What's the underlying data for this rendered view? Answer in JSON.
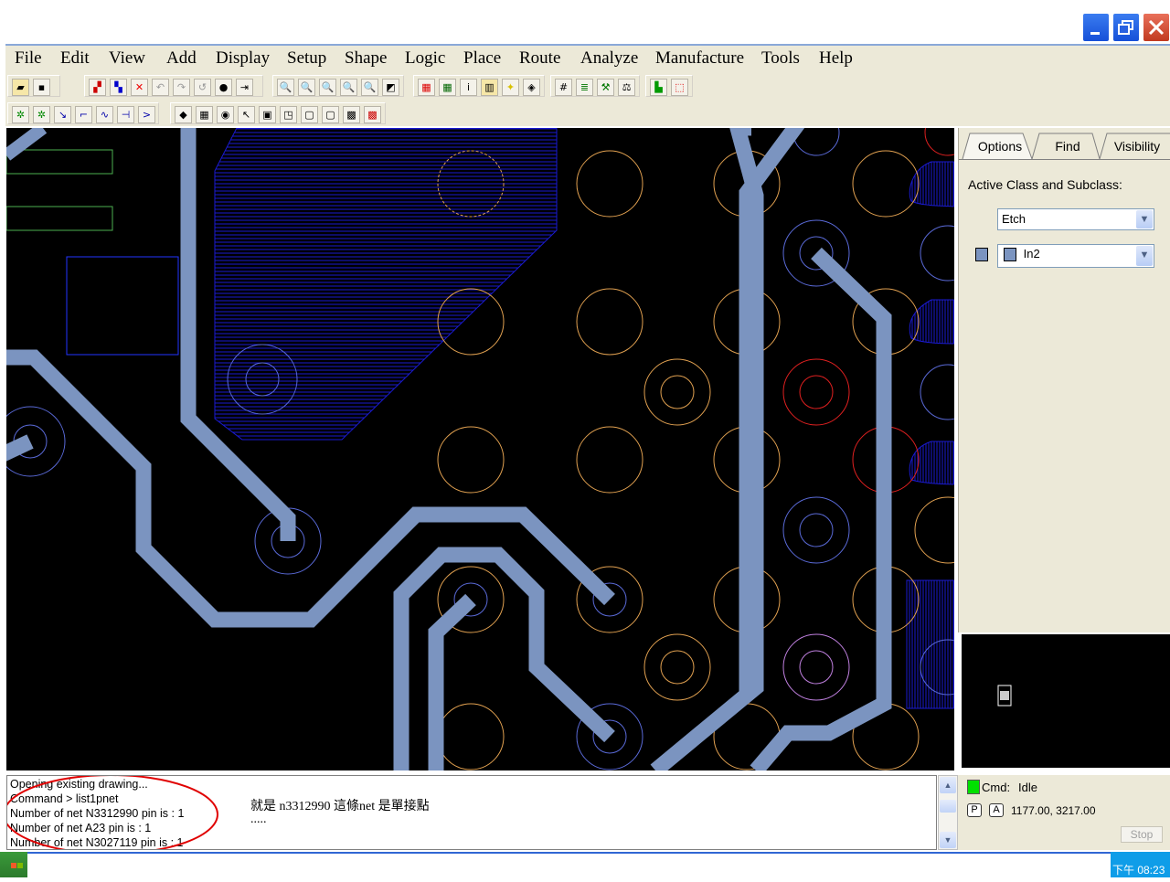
{
  "menu": [
    "File",
    "Edit",
    "View",
    "Add",
    "Display",
    "Setup",
    "Shape",
    "Logic",
    "Place",
    "Route",
    "Analyze",
    "Manufacture",
    "Tools",
    "Help"
  ],
  "panel": {
    "tabs": [
      "Options",
      "Find",
      "Visibility"
    ],
    "active_class_label": "Active Class and Subclass:",
    "class_value": "Etch",
    "subclass_value": "In2",
    "subclass_color": "#7b94c0"
  },
  "console": {
    "lines": [
      "Opening existing drawing...",
      "Command > list1pnet",
      "Number of net N3312990 pin is : 1",
      "Number of net A23 pin is : 1",
      "Number of net N3027119 pin is : 1"
    ],
    "annotation": "就是 n3312990 這條net 是單接點",
    "annotation_dots": "....."
  },
  "status": {
    "cmd_label": "Cmd:",
    "cmd_value": "Idle",
    "p_label": "P",
    "a_label": "A",
    "coords": "1177.00, 3217.00",
    "stop_label": "Stop"
  },
  "taskbar": {
    "clock": "下午 08:23"
  },
  "colors": {
    "trace": "#7b94c0",
    "shape_hatch": "#1a1ad0",
    "pad_orange": "#e0a050",
    "pad_red": "#e02020",
    "pad_blue": "#5a6ad8",
    "annotation_circle": "#e00000"
  }
}
